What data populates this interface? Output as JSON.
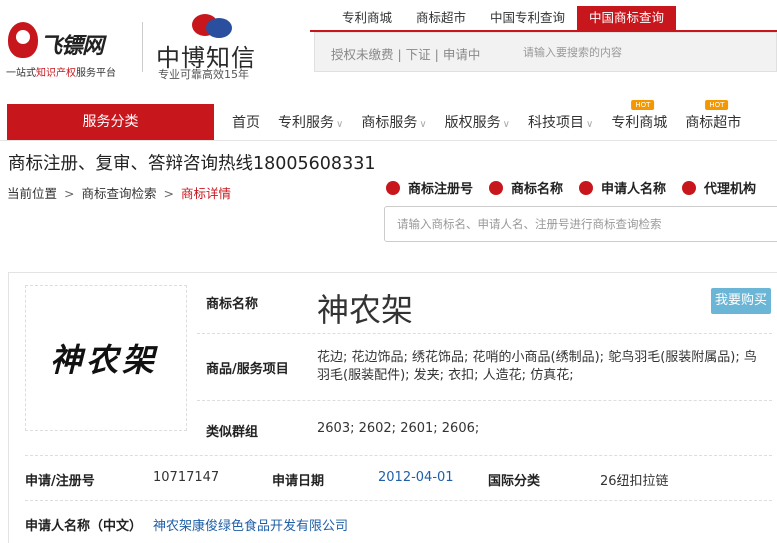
{
  "logo_left": {
    "name": "飞镖网",
    "slogan_pre": "一站式",
    "slogan_red": "知识产权",
    "slogan_post": "服务平台"
  },
  "logo_right": {
    "name": "中博知信",
    "slogan": "专业可靠高效15年"
  },
  "top_links": [
    "专利商城",
    "商标超市",
    "中国专利查询",
    "中国商标查询"
  ],
  "top_search": {
    "meta": "授权未缴费 | 下证 | 申请中",
    "placeholder": "请输入要搜索的内容"
  },
  "nav": {
    "category_label": "服务分类",
    "items": [
      {
        "label": "首页",
        "dropdown": false,
        "hot": ""
      },
      {
        "label": "专利服务",
        "dropdown": true,
        "hot": ""
      },
      {
        "label": "商标服务",
        "dropdown": true,
        "hot": ""
      },
      {
        "label": "版权服务",
        "dropdown": true,
        "hot": ""
      },
      {
        "label": "科技项目",
        "dropdown": true,
        "hot": ""
      },
      {
        "label": "专利商城",
        "dropdown": false,
        "hot": "HOT"
      },
      {
        "label": "商标超市",
        "dropdown": false,
        "hot": "HOT"
      }
    ]
  },
  "hotline": "商标注册、复审、答辩咨询热线18005608331",
  "breadcrumb": {
    "items": [
      "当前位置",
      "商标查询检索",
      "商标详情"
    ],
    "sep": ">"
  },
  "filters": [
    "商标注册号",
    "商标名称",
    "申请人名称",
    "代理机构"
  ],
  "main_search": {
    "placeholder": "请输入商标名、申请人名、注册号进行商标查询检索"
  },
  "detail": {
    "image_text": "神农架",
    "name_label": "商标名称",
    "name_value": "神农架",
    "buy_label": "我要购买",
    "goods_label": "商品/服务项目",
    "goods_value": "花边; 花边饰品; 绣花饰品; 花哨的小商品(绣制品); 鸵鸟羽毛(服装附属品); 鸟羽毛(服装配件); 发夹; 衣扣; 人造花; 仿真花;",
    "group_label": "类似群组",
    "group_value": "2603; 2602; 2601; 2606;",
    "reg_label": "申请/注册号",
    "reg_value": "10717147",
    "date_label": "申请日期",
    "date_value": "2012-04-01",
    "class_label": "国际分类",
    "class_value": "26纽扣拉链",
    "applicant_label": "申请人名称（中文）",
    "applicant_value": "神农架康俊绿色食品开发有限公司"
  },
  "colors": {
    "brand_red": "#c8161d",
    "link_blue": "#1f5fa8",
    "buy_button": "#6bb6d6",
    "hot_badge": "#f39800"
  }
}
